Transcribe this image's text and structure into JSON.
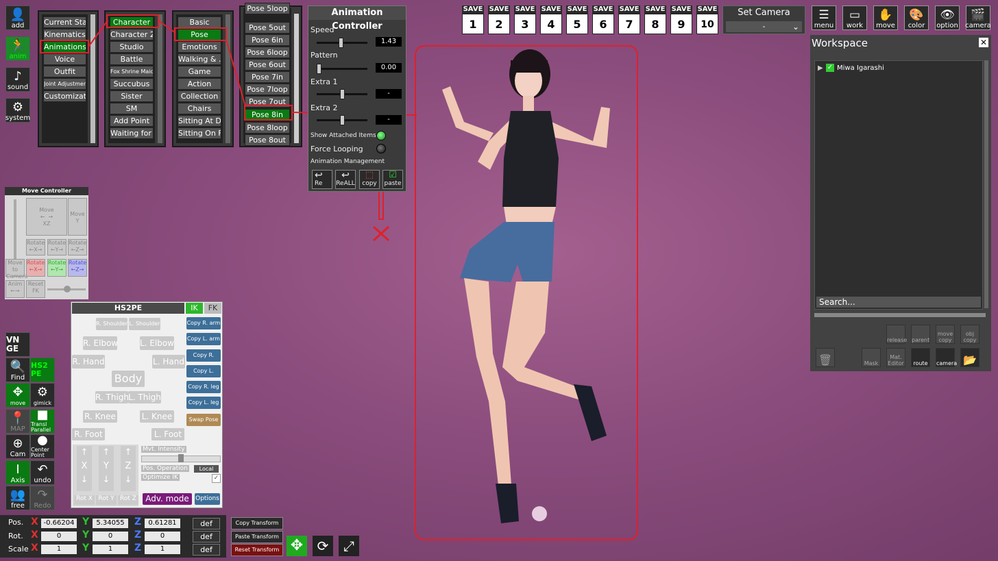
{
  "left_toolbar": [
    {
      "label": "add",
      "icon": "person-icon"
    },
    {
      "label": "anim",
      "icon": "running-person-icon"
    },
    {
      "label": "sound",
      "icon": "music-note-icon"
    },
    {
      "label": "system",
      "icon": "gears-icon"
    }
  ],
  "menu_columns": {
    "col1": [
      "Current State",
      "Kinematics",
      "Animations",
      "Voice",
      "Outfit",
      "Joint Adjustment",
      "Customization"
    ],
    "col2": [
      "Character",
      "Character 2",
      "Studio",
      "Battle",
      "Fox Shrine Maiden",
      "Succubus",
      "Sister",
      "SM",
      "Add Point",
      "Waiting for H"
    ],
    "col3": [
      "Basic",
      "Pose",
      "Emotions",
      "Walking & ...",
      "Game",
      "Action",
      "Collection",
      "Chairs",
      "Sitting At D...",
      "Sitting On F..."
    ],
    "col4": [
      "Pose 5loop",
      "Pose 5out",
      "Pose 6in",
      "Pose 6loop",
      "Pose 6out",
      "Pose 7in",
      "Pose 7loop",
      "Pose 7out",
      "Pose 8in",
      "Pose 8loop",
      "Pose 8out"
    ]
  },
  "anim_controller": {
    "title": "Animation Controller",
    "speed_label": "Speed",
    "speed_value": "1.43",
    "speed_pos": 0.5,
    "pattern_label": "Pattern",
    "pattern_value": "0.00",
    "pattern_pos": 0.0,
    "extra1_label": "Extra 1",
    "extra1_value": "-",
    "extra2_label": "Extra 2",
    "extra2_value": "-",
    "show_attached": "Show Attached Items",
    "force_looping": "Force Looping",
    "anim_management": "Animation Management",
    "buttons": [
      "Re",
      "ReALL",
      "copy",
      "paste"
    ]
  },
  "save_slots": {
    "label": "SAVE",
    "slots": [
      "1",
      "2",
      "3",
      "4",
      "5",
      "6",
      "7",
      "8",
      "9",
      "10"
    ]
  },
  "set_camera": {
    "title": "Set Camera",
    "value": "-"
  },
  "right_toolbar": [
    {
      "label": "menu",
      "icon": "menu-icon"
    },
    {
      "label": "work",
      "icon": "window-icon"
    },
    {
      "label": "move",
      "icon": "hand-icon"
    },
    {
      "label": "color",
      "icon": "palette-icon"
    },
    {
      "label": "option",
      "icon": "eye-icon"
    },
    {
      "label": "camera",
      "icon": "clapper-icon"
    }
  ],
  "workspace": {
    "title": "Workspace",
    "items": [
      "Miwa Igarashi"
    ],
    "search_placeholder": "Search...",
    "icons_row1": [
      "release",
      "parent",
      "move copy",
      "obj copy"
    ],
    "icons_row2": [
      "Mask",
      "Mat. Editor",
      "route",
      "camera"
    ]
  },
  "move_controller": {
    "title": "Move Controller",
    "move_xz": "Move\n←  →\nXZ",
    "move_y": "Move\nY",
    "rot": [
      "Rotate ←X→",
      "Rotate ←Y→",
      "Rotate ←Z→"
    ],
    "rot2": [
      "Rotate ←X→",
      "Rotate ←Y→",
      "Rotate ←Z→"
    ],
    "move_to_camera": "Move to Camera",
    "anim": "Anim ←→",
    "reset_fk": "Reset FK"
  },
  "left_tools": [
    {
      "label": "VN GE"
    },
    {
      "label": "Find"
    },
    {
      "label": "HS2 PE"
    },
    {
      "label": "move"
    },
    {
      "label": "gimick"
    },
    {
      "label": "MAP"
    },
    {
      "label": "Transl Parallel"
    },
    {
      "label": "Cam"
    },
    {
      "label": "Center Point"
    },
    {
      "label": "Axis"
    },
    {
      "label": "undo"
    },
    {
      "label": "free"
    },
    {
      "label": "Redo"
    }
  ],
  "hs2pe": {
    "title": "HS2PE",
    "ik": "IK",
    "fk": "FK",
    "r_shoulder": "R. Shoulder",
    "l_shoulder": "L. Shoulder",
    "r_elbow": "R. Elbow",
    "l_elbow": "L. Elbow",
    "r_hand": "R. Hand",
    "l_hand": "L. Hand",
    "body": "Body",
    "r_thigh": "R. Thigh",
    "l_thigh": "L. Thigh",
    "r_knee": "R. Knee",
    "l_knee": "L. Knee",
    "r_foot": "R. Foot",
    "l_foot": "L. Foot",
    "copy_buttons": [
      "Copy R. arm",
      "Copy L. arm",
      "Copy R. hand",
      "Copy L. hand",
      "Copy R. leg",
      "Copy L. leg"
    ],
    "swap_pose": "Swap Pose",
    "axes": [
      "X",
      "Y",
      "Z"
    ],
    "rot": [
      "Rot X",
      "Rot Y",
      "Rot Z"
    ],
    "mvt_intensity": "Mvt. Intensity",
    "pos_operation": "Pos. Operation",
    "pos_op_value": "Local",
    "optimize_ik": "Optimize IK",
    "adv_mode": "Adv. mode",
    "options": "Options"
  },
  "transform": {
    "pos_label": "Pos.",
    "rot_label": "Rot.",
    "scale_label": "Scale",
    "pos": [
      "-0.66204",
      "5.34055",
      "0.61281"
    ],
    "rot": [
      "0",
      "0",
      "0"
    ],
    "scale": [
      "1",
      "1",
      "1"
    ],
    "def": "def",
    "copy": "Copy Transform",
    "paste": "Paste Transform",
    "reset": "Reset Transform"
  }
}
